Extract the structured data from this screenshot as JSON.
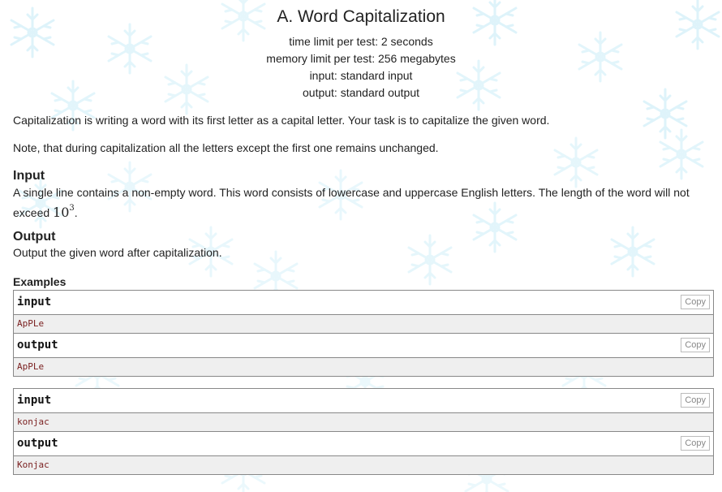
{
  "problem": {
    "title": "A. Word Capitalization",
    "time_limit": "time limit per test: 2 seconds",
    "memory_limit": "memory limit per test: 256 megabytes",
    "input_src": "input: standard input",
    "output_src": "output: standard output",
    "statement_1": "Capitalization is writing a word with its first letter as a capital letter. Your task is to capitalize the given word.",
    "statement_2": "Note, that during capitalization all the letters except the first one remains unchanged."
  },
  "input_section": {
    "title": "Input",
    "text_before": "A single line contains a non-empty word. This word consists of lowercase and uppercase English letters. The length of the word will not exceed ",
    "math_base": "10",
    "math_exp": "3",
    "text_after": "."
  },
  "output_section": {
    "title": "Output",
    "text": "Output the given word after capitalization."
  },
  "examples": {
    "label": "Examples",
    "copy_label": "Copy",
    "tests": [
      {
        "input_title": "input",
        "input": "ApPLe",
        "output_title": "output",
        "output": "ApPLe"
      },
      {
        "input_title": "input",
        "input": "konjac",
        "output_title": "output",
        "output": "Konjac"
      }
    ]
  },
  "colors": {
    "snowflake": "#bfe9f7",
    "border": "#888888",
    "sample_bg": "#efefef",
    "sample_text": "#7a1f1f"
  }
}
